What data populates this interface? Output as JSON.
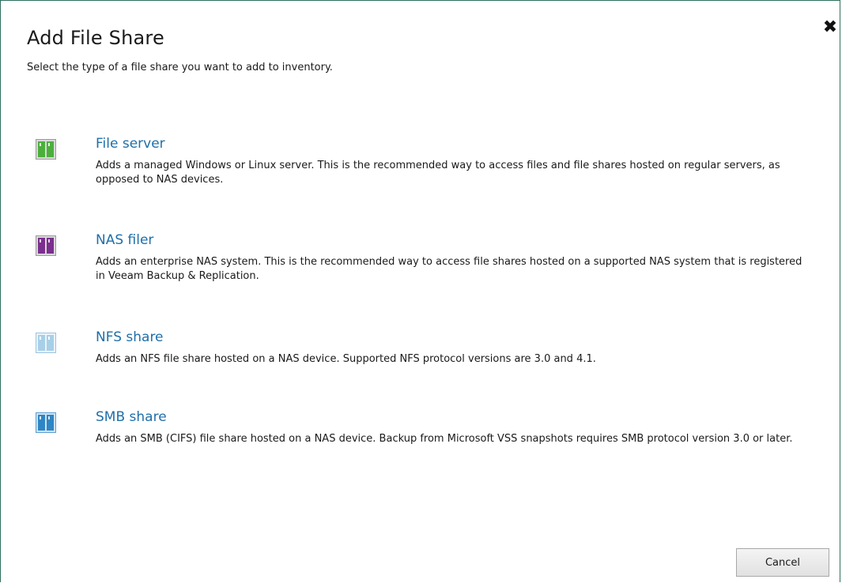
{
  "dialog": {
    "title": "Add File Share",
    "subtitle": "Select the type of a file share you want to add to inventory.",
    "close_label": "✖"
  },
  "options": [
    {
      "name": "File server",
      "description": "Adds a managed Windows or Linux server. This is the recommended way to access files and file shares hosted on regular servers, as opposed to NAS devices.",
      "icon": "file-server-icon",
      "icon_color": "#4caf3c"
    },
    {
      "name": "NAS filer",
      "description": "Adds an enterprise NAS system. This is the recommended way to access file shares hosted on a supported NAS system that is registered in Veeam Backup & Replication.",
      "icon": "nas-filer-icon",
      "icon_color": "#7b2f8e"
    },
    {
      "name": "NFS share",
      "description": "Adds an NFS file share hosted on a NAS device. Supported NFS protocol versions are 3.0 and 4.1.",
      "icon": "nfs-share-icon",
      "icon_color": "#a8cfe8"
    },
    {
      "name": "SMB share",
      "description": "Adds an SMB (CIFS) file share hosted on a NAS device. Backup from Microsoft VSS snapshots requires SMB protocol version 3.0 or later.",
      "icon": "smb-share-icon",
      "icon_color": "#2f86c4"
    }
  ],
  "footer": {
    "cancel_label": "Cancel"
  }
}
